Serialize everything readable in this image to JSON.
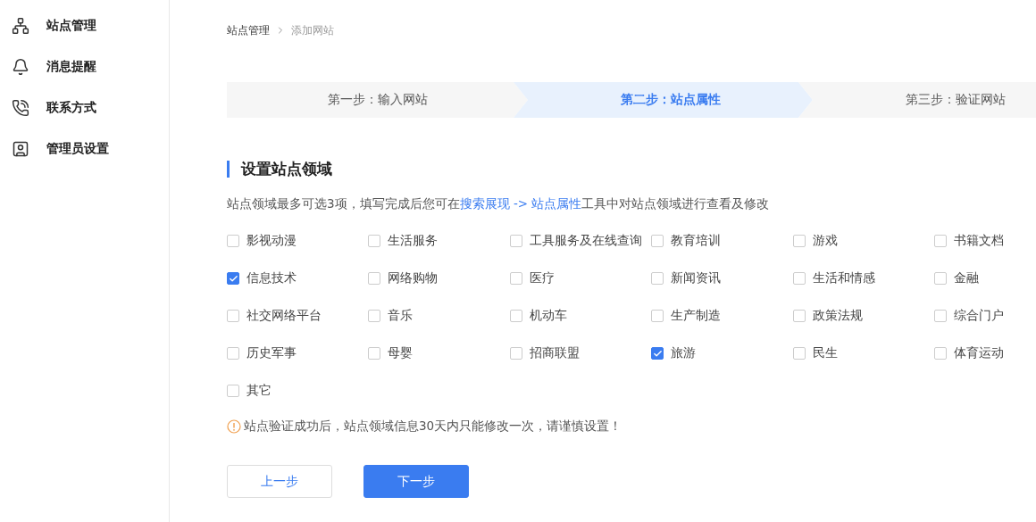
{
  "sidebar": {
    "items": [
      {
        "kind": "sitemap",
        "label": "站点管理"
      },
      {
        "kind": "bell",
        "label": "消息提醒"
      },
      {
        "kind": "phone",
        "label": "联系方式"
      },
      {
        "kind": "admin",
        "label": "管理员设置"
      }
    ]
  },
  "breadcrumb": [
    "站点管理",
    "添加网站"
  ],
  "steps": [
    {
      "label": "第一步：输入网站",
      "selected": false
    },
    {
      "label": "第二步：站点属性",
      "selected": true
    },
    {
      "label": "第三步：验证网站",
      "selected": false
    }
  ],
  "section_title": "设置站点领域",
  "description": [
    {
      "text": "站点领域最多可选3项，填写完成后您可在",
      "link": false
    },
    {
      "text": "搜索展现 -> 站点属性",
      "link": true
    },
    {
      "text": "工具中对站点领域进行查看及修改",
      "link": false
    }
  ],
  "domains": [
    {
      "label": "影视动漫",
      "checked": false
    },
    {
      "label": "生活服务",
      "checked": false
    },
    {
      "label": "工具服务及在线查询",
      "checked": false
    },
    {
      "label": "教育培训",
      "checked": false
    },
    {
      "label": "游戏",
      "checked": false
    },
    {
      "label": "书籍文档",
      "checked": false
    },
    {
      "label": "信息技术",
      "checked": true
    },
    {
      "label": "网络购物",
      "checked": false
    },
    {
      "label": "医疗",
      "checked": false
    },
    {
      "label": "新闻资讯",
      "checked": false
    },
    {
      "label": "生活和情感",
      "checked": false
    },
    {
      "label": "金融",
      "checked": false
    },
    {
      "label": "社交网络平台",
      "checked": false
    },
    {
      "label": "音乐",
      "checked": false
    },
    {
      "label": "机动车",
      "checked": false
    },
    {
      "label": "生产制造",
      "checked": false
    },
    {
      "label": "政策法规",
      "checked": false
    },
    {
      "label": "综合门户",
      "checked": false
    },
    {
      "label": "历史军事",
      "checked": false
    },
    {
      "label": "母婴",
      "checked": false
    },
    {
      "label": "招商联盟",
      "checked": false
    },
    {
      "label": "旅游",
      "checked": true
    },
    {
      "label": "民生",
      "checked": false
    },
    {
      "label": "体育运动",
      "checked": false
    },
    {
      "label": "其它",
      "checked": false
    }
  ],
  "warning": "站点验证成功后，站点领域信息30天内只能修改一次，请谨慎设置！",
  "buttons": {
    "prev": "上一步",
    "next": "下一步"
  }
}
